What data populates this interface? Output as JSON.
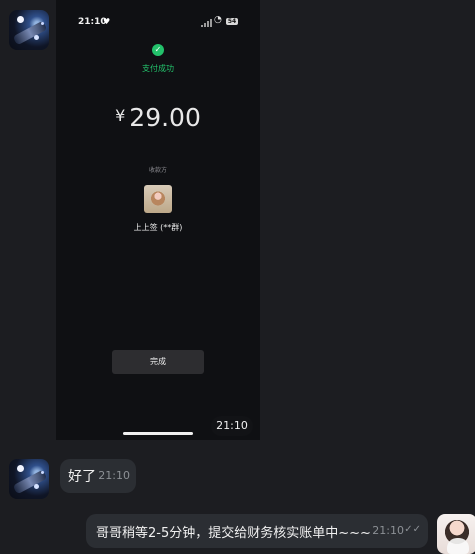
{
  "phone": {
    "status_time": "21:10",
    "heart": "♥",
    "wifi": "📶",
    "battery": "54",
    "success_icon": "✓",
    "success_text": "支付成功",
    "currency": "¥",
    "amount": "29.00",
    "payee_label": "收款方",
    "payee_name": "上上签 (**群)",
    "done_button": "完成"
  },
  "messages": {
    "time_pill": "21:10",
    "reply_text": "好了",
    "reply_time": "21:10",
    "agent_text": "哥哥稍等2-5分钟，提交给财务核实账单中~~~",
    "agent_time": "21:10",
    "read_icon": "✓✓"
  }
}
